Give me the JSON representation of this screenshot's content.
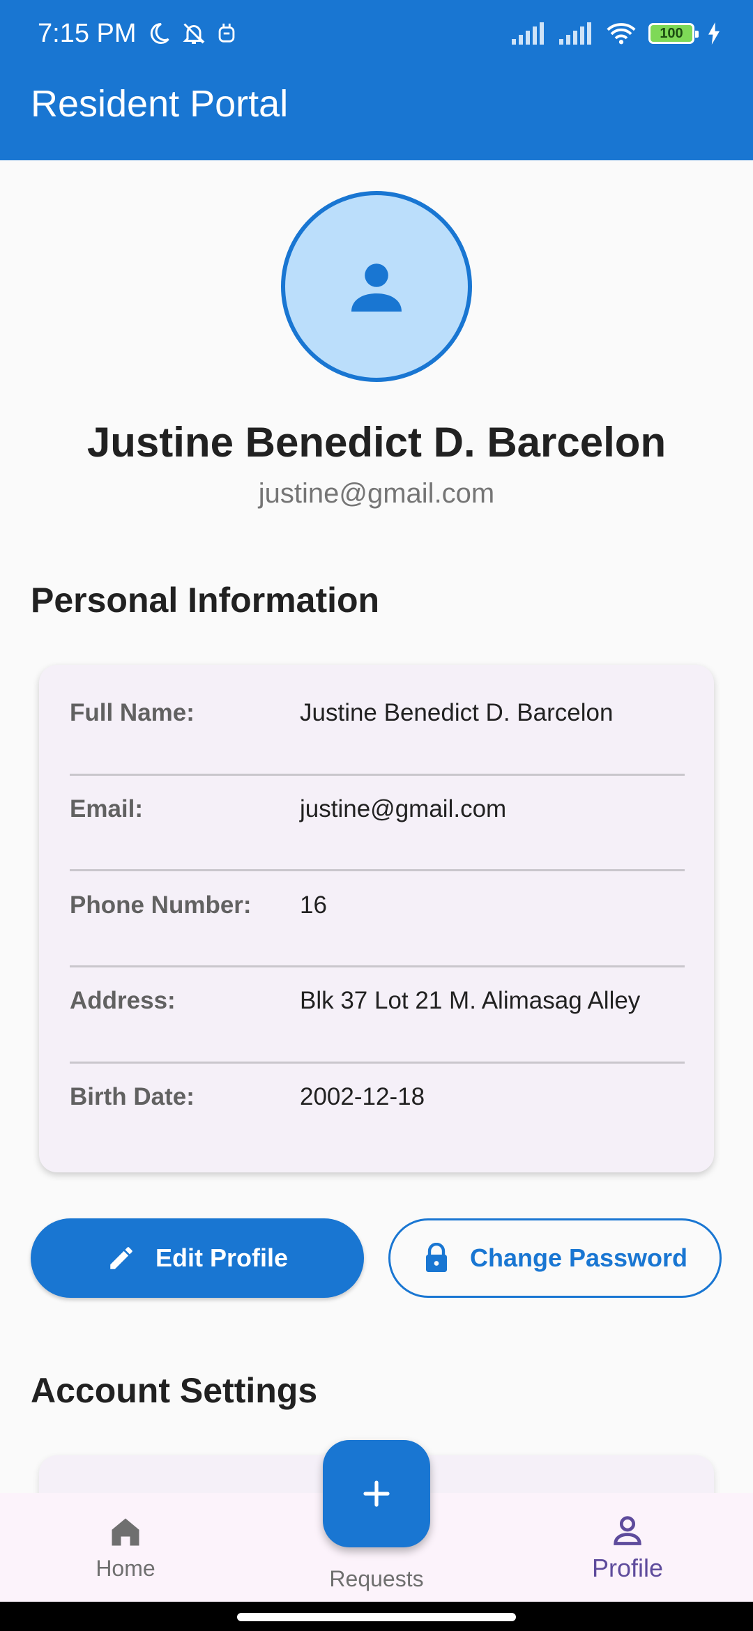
{
  "status_bar": {
    "time": "7:15 PM",
    "battery": "100",
    "icons": [
      "moon-icon",
      "bell-off-icon",
      "robot-icon",
      "signal-icon",
      "signal-icon",
      "wifi-icon",
      "battery-icon",
      "charging-icon"
    ]
  },
  "app_bar": {
    "title": "Resident Portal"
  },
  "profile": {
    "name": "Justine Benedict D. Barcelon",
    "email": "justine@gmail.com",
    "avatar_icon": "person-icon"
  },
  "personal_info": {
    "title": "Personal Information",
    "rows": [
      {
        "label": "Full Name:",
        "value": "Justine Benedict D. Barcelon"
      },
      {
        "label": "Email:",
        "value": "justine@gmail.com"
      },
      {
        "label": "Phone Number:",
        "value": "16"
      },
      {
        "label": "Address:",
        "value": "Blk 37 Lot 21 M. Alimasag Alley"
      },
      {
        "label": "Birth Date:",
        "value": "2002-12-18"
      }
    ]
  },
  "actions": {
    "edit_label": "Edit Profile",
    "change_password_label": "Change Password"
  },
  "account_settings": {
    "title": "Account Settings"
  },
  "bottom_nav": {
    "items": [
      {
        "label": "Home",
        "icon": "home-icon"
      },
      {
        "label": "Requests",
        "icon": "plus-icon"
      },
      {
        "label": "Profile",
        "icon": "person-outline-icon"
      }
    ],
    "active": "Profile"
  },
  "colors": {
    "primary": "#1976d2",
    "avatar_bg": "#bbdefb",
    "card_bg": "#f5f0f8",
    "nav_active": "#5e4b9c"
  }
}
